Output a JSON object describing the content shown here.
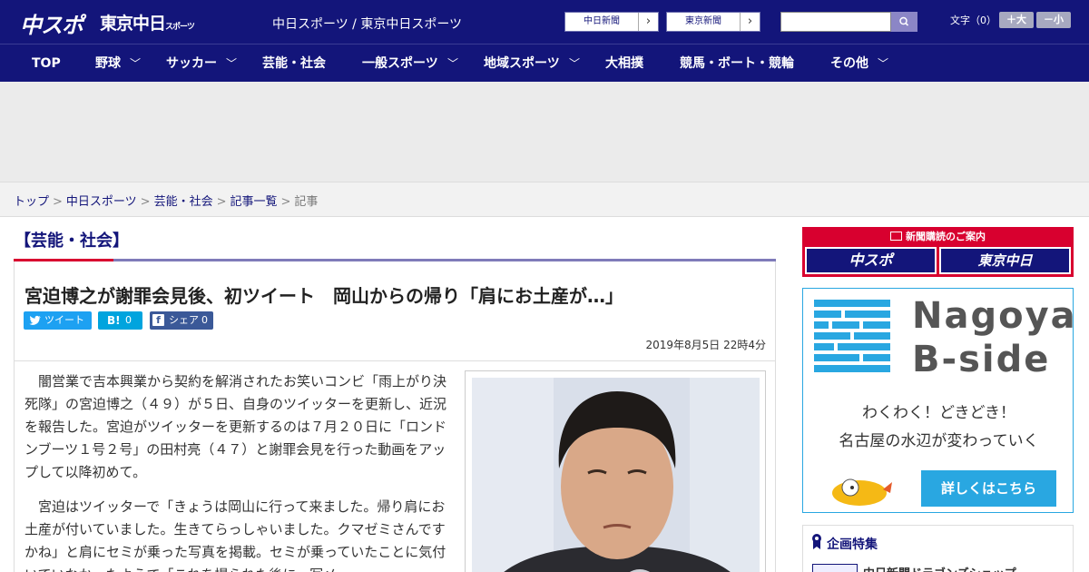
{
  "header": {
    "logo_chuspo": "中スポ",
    "logo_tokyo": "東京中日",
    "logo_tokyo_small": "スポーツ",
    "site_name": "中日スポーツ / 東京中日スポーツ",
    "paper_links": [
      {
        "label": "中日新聞",
        "arrow": "›"
      },
      {
        "label": "東京新聞",
        "arrow": "›"
      }
    ],
    "search_placeholder": "",
    "text_size_label": "文字（0）",
    "size_up": "＋大",
    "size_down": "－小"
  },
  "nav": {
    "items": [
      {
        "label": "TOP",
        "chevron": ""
      },
      {
        "label": "野球",
        "chevron": "﹀"
      },
      {
        "label": "サッカー",
        "chevron": "﹀"
      },
      {
        "label": "芸能・社会",
        "chevron": ""
      },
      {
        "label": "一般スポーツ",
        "chevron": "﹀"
      },
      {
        "label": "地域スポーツ",
        "chevron": "﹀"
      },
      {
        "label": "大相撲",
        "chevron": ""
      },
      {
        "label": "競馬・ボート・競輪",
        "chevron": ""
      },
      {
        "label": "その他",
        "chevron": "﹀"
      }
    ]
  },
  "breadcrumb": {
    "items": [
      "トップ",
      "中日スポーツ",
      "芸能・社会",
      "記事一覧"
    ],
    "current": "記事",
    "separator": ">"
  },
  "article": {
    "category": "【芸能・社会】",
    "headline": "宮迫博之が謝罪会見後、初ツイート　岡山からの帰り「肩にお土産が…」",
    "share": {
      "tweet": "ツイート",
      "hatena_icon": "B!",
      "hatena_count": "0",
      "facebook_icon": "f",
      "facebook_label": "シェア",
      "facebook_count": "0"
    },
    "date": "2019年8月5日 22時4分",
    "paragraphs": [
      "闇営業で吉本興業から契約を解消されたお笑いコンビ「雨上がり決死隊」の宮迫博之（４９）が５日、自身のツイッターを更新し、近況を報告した。宮迫がツイッターを更新するのは７月２０日に「ロンドンブーツ１号２号」の田村亮（４７）と謝罪会見を行った動画をアップして以降初めて。",
      "宮迫はツイッターで「きょうは岡山に行って来ました。帰り肩にお土産が付いていました。生きてらっしゃいました。クマゼミさんですかね」と肩にセミが乗った写真を掲載。セミが乗っていたことに気付いていなかったようで「これを撮られた後に、写メ"
    ]
  },
  "sidebar": {
    "subscription_title": "新聞購読のご案内",
    "subscription_buttons": [
      {
        "label": "中スポ"
      },
      {
        "label": "東京中日"
      }
    ],
    "banner": {
      "title_line1": "Nagoya",
      "title_line2": "B-side",
      "tagline1": "わくわく！どきどき！",
      "tagline2": "名古屋の水辺が変わっていく",
      "cta": "詳しくはこちら"
    },
    "feature_title": "企画特集",
    "feature_item": "中日新聞ドラゴンズショップ"
  },
  "colors": {
    "brand_navy": "#13157a",
    "accent_red": "#d8002f",
    "banner_blue": "#29a7e1",
    "twitter": "#1da1f2",
    "hatena": "#00a4de",
    "facebook": "#3b5998"
  }
}
